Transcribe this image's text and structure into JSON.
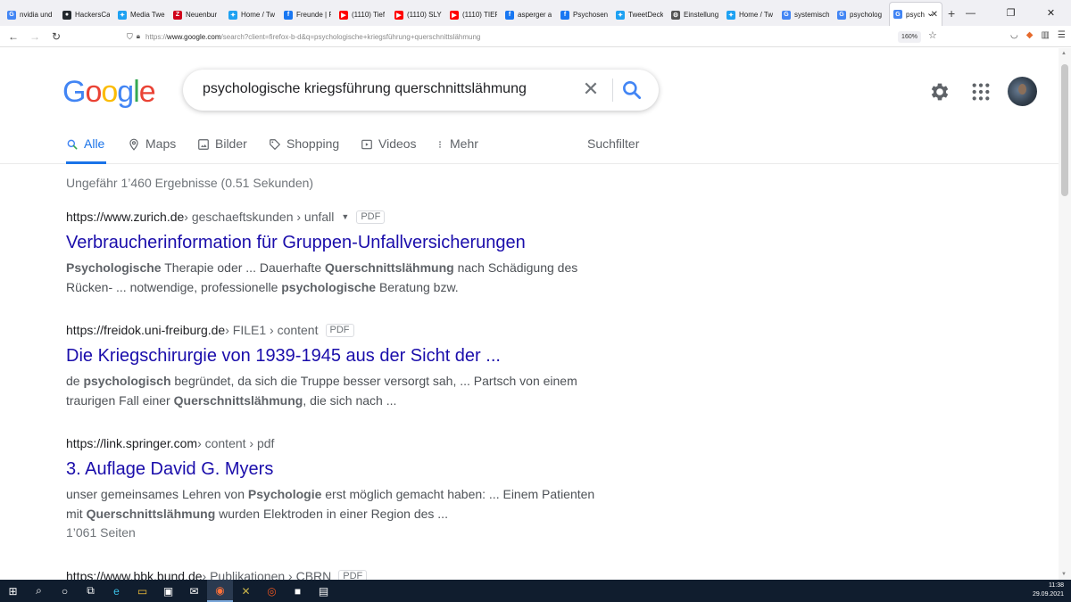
{
  "browser": {
    "tabs": [
      {
        "label": "nvidia und",
        "icon": "google-favicon",
        "color": "#4285f4"
      },
      {
        "label": "HackersCa",
        "icon": "github-favicon",
        "color": "#24292e"
      },
      {
        "label": "Media Twe",
        "icon": "twitter-favicon",
        "color": "#1da1f2"
      },
      {
        "label": "Neuenbur",
        "icon": "z-favicon",
        "color": "#d0021b"
      },
      {
        "label": "Home / Tw",
        "icon": "twitter-favicon",
        "color": "#1da1f2"
      },
      {
        "label": "Freunde | F",
        "icon": "facebook-favicon",
        "color": "#1877f2"
      },
      {
        "label": "(1110) Tief",
        "icon": "youtube-favicon",
        "color": "#ff0000"
      },
      {
        "label": "(1110) SLY",
        "icon": "youtube-favicon",
        "color": "#ff0000"
      },
      {
        "label": "(1110) TIEF",
        "icon": "youtube-favicon",
        "color": "#ff0000"
      },
      {
        "label": "asperger a",
        "icon": "facebook-favicon",
        "color": "#1877f2"
      },
      {
        "label": "Psychosen",
        "icon": "facebook-favicon",
        "color": "#1877f2"
      },
      {
        "label": "TweetDeck",
        "icon": "tweetdeck-favicon",
        "color": "#1da1f2"
      },
      {
        "label": "Einstellung",
        "icon": "gear-favicon",
        "color": "#555555"
      },
      {
        "label": "Home / Tw",
        "icon": "twitter-favicon",
        "color": "#1da1f2"
      },
      {
        "label": "systemisch",
        "icon": "google-favicon",
        "color": "#4285f4"
      },
      {
        "label": "psycholog",
        "icon": "google-favicon",
        "color": "#4285f4"
      },
      {
        "label": "psycholo",
        "icon": "google-favicon",
        "color": "#4285f4",
        "active": true
      }
    ],
    "url_prefix": "https://",
    "url_domain": "www.google.com",
    "url_rest": "/search?client=firefox-b-d&q=psychologische+kriegsführung+querschnittslähmung",
    "zoom": "160%"
  },
  "google": {
    "logo": [
      "G",
      "o",
      "o",
      "g",
      "l",
      "e"
    ],
    "query": "psychologische kriegsführung querschnittslähmung",
    "tabs": {
      "all": "Alle",
      "maps": "Maps",
      "images": "Bilder",
      "shopping": "Shopping",
      "videos": "Videos",
      "more": "Mehr",
      "tools": "Suchfilter"
    },
    "stats": "Ungefähr 1’460 Ergebnisse (0.51 Sekunden)",
    "results": [
      {
        "domain": "https://www.zurich.de",
        "path": " › geschaeftskunden › unfall",
        "has_caret": true,
        "badge": "PDF",
        "title": "Verbraucherinformation für Gruppen-Unfallversicherungen",
        "snippet": [
          {
            "b": true,
            "t": "Psychologische"
          },
          {
            "b": false,
            "t": " Therapie oder ... Dauerhafte "
          },
          {
            "b": true,
            "t": "Querschnittslähmung"
          },
          {
            "b": false,
            "t": " nach Schädigung des Rücken- ... notwendige, professionelle "
          },
          {
            "b": true,
            "t": "psychologische"
          },
          {
            "b": false,
            "t": " Beratung bzw."
          }
        ]
      },
      {
        "domain": "https://freidok.uni-freiburg.de",
        "path": " › FILE1 › content",
        "badge": "PDF",
        "title": "Die Kriegschirurgie von 1939-1945 aus der Sicht der ...",
        "snippet": [
          {
            "b": false,
            "t": "de "
          },
          {
            "b": true,
            "t": "psychologisch"
          },
          {
            "b": false,
            "t": " begründet, da sich die Truppe besser versorgt sah, ... Partsch von einem traurigen Fall einer "
          },
          {
            "b": true,
            "t": "Querschnittslähmung"
          },
          {
            "b": false,
            "t": ", die sich nach ..."
          }
        ]
      },
      {
        "domain": "https://link.springer.com",
        "path": " › content › pdf",
        "title": "3. Auflage David G. Myers",
        "snippet": [
          {
            "b": false,
            "t": "unser gemeinsames Lehren von "
          },
          {
            "b": true,
            "t": "Psychologie"
          },
          {
            "b": false,
            "t": " erst möglich gemacht haben: ... Einem Patienten mit "
          },
          {
            "b": true,
            "t": "Querschnittslähmung"
          },
          {
            "b": false,
            "t": " wurden Elektroden in einer Region des ..."
          }
        ],
        "extra": "1’061 Seiten"
      },
      {
        "domain": "https://www.bbk.bund.de",
        "path": " › Publikationen › CBRN",
        "badge": "PDF"
      }
    ]
  },
  "taskbar": {
    "time": "11:38",
    "date": "29.09.2021",
    "icons": [
      {
        "name": "windows-start-icon",
        "glyph": "⊞"
      },
      {
        "name": "search-icon",
        "glyph": "⌕"
      },
      {
        "name": "cortana-icon",
        "glyph": "○"
      },
      {
        "name": "task-view-icon",
        "glyph": "⧉"
      },
      {
        "name": "edge-icon",
        "glyph": "e"
      },
      {
        "name": "file-explorer-icon",
        "glyph": "▭"
      },
      {
        "name": "store-icon",
        "glyph": "▣"
      },
      {
        "name": "mail-icon",
        "glyph": "✉"
      },
      {
        "name": "firefox-icon",
        "glyph": "◉"
      },
      {
        "name": "app-x-icon",
        "glyph": "✕"
      },
      {
        "name": "ubuntu-icon",
        "glyph": "◎"
      },
      {
        "name": "app-dark-icon",
        "glyph": "■"
      },
      {
        "name": "notes-icon",
        "glyph": "▤"
      }
    ]
  }
}
